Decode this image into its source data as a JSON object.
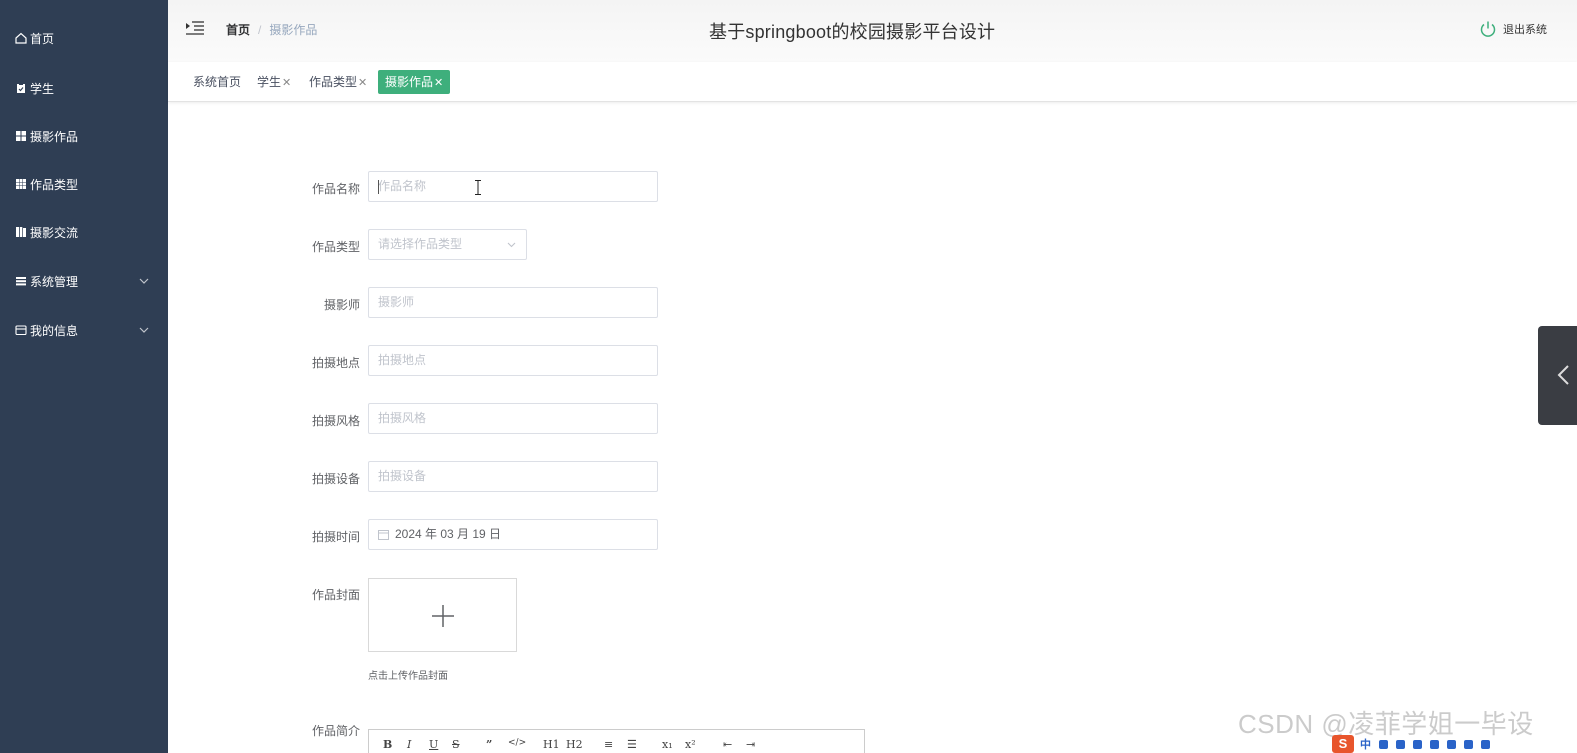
{
  "header": {
    "title": "基于springboot的校园摄影平台设计",
    "breadcrumb": {
      "home": "首页",
      "separator": "/",
      "current": "摄影作品"
    },
    "logout": "退出系统"
  },
  "sidebar": {
    "items": [
      {
        "label": "首页",
        "icon": "home-icon"
      },
      {
        "label": "学生",
        "icon": "clipboard-icon"
      },
      {
        "label": "摄影作品",
        "icon": "grid-icon"
      },
      {
        "label": "作品类型",
        "icon": "table-icon"
      },
      {
        "label": "摄影交流",
        "icon": "book-icon"
      },
      {
        "label": "系统管理",
        "icon": "list-icon"
      },
      {
        "label": "我的信息",
        "icon": "wallet-icon"
      }
    ]
  },
  "tags": [
    {
      "label": "系统首页",
      "close": ""
    },
    {
      "label": "学生",
      "close": "✕"
    },
    {
      "label": "作品类型",
      "close": "✕"
    },
    {
      "label": "摄影作品",
      "close": "✕"
    }
  ],
  "form": {
    "name": {
      "label": "作品名称",
      "placeholder": "作品名称"
    },
    "type": {
      "label": "作品类型",
      "placeholder": "请选择作品类型"
    },
    "photographer": {
      "label": "摄影师",
      "placeholder": "摄影师"
    },
    "location": {
      "label": "拍摄地点",
      "placeholder": "拍摄地点"
    },
    "style": {
      "label": "拍摄风格",
      "placeholder": "拍摄风格"
    },
    "device": {
      "label": "拍摄设备",
      "placeholder": "拍摄设备"
    },
    "time": {
      "label": "拍摄时间",
      "value": "2024 年 03 月 19 日"
    },
    "cover": {
      "label": "作品封面",
      "hint": "点击上传作品封面"
    },
    "intro": {
      "label": "作品简介"
    }
  },
  "editor_toolbar": [
    "B",
    "I",
    "U",
    "S",
    "”",
    "</>",
    "H1",
    "H2",
    "≡",
    "☰",
    "x₁",
    "x²",
    "⇤",
    "⇥"
  ],
  "watermark": "CSDN @凌菲学姐一毕设",
  "ime": {
    "badge": "S",
    "mode": "中"
  },
  "colors": {
    "sidebar": "#2f3e54",
    "accent": "#3eaf7c"
  }
}
